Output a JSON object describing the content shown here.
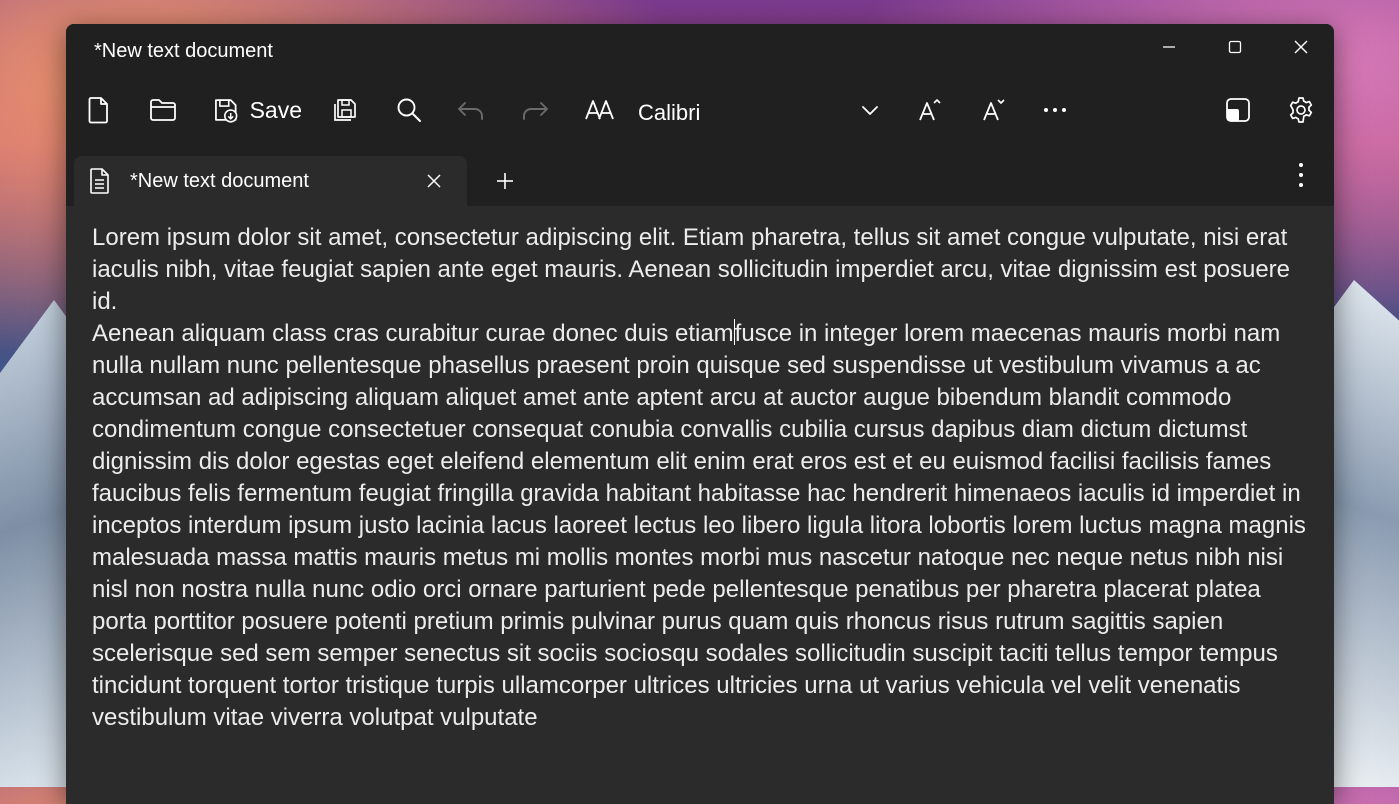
{
  "window": {
    "title": "*New text document"
  },
  "toolbar": {
    "save_label": "Save",
    "font_name": "Calibri"
  },
  "tab": {
    "label": "*New text document"
  },
  "editor": {
    "paragraph1": "Lorem ipsum dolor sit amet, consectetur adipiscing elit. Etiam pharetra, tellus sit amet congue vulputate, nisi erat iaculis nibh, vitae feugiat sapien ante eget mauris. Aenean sollicitudin imperdiet arcu, vitae dignissim est posuere id.",
    "paragraph2_before_caret": "Aenean aliquam class cras curabitur curae donec duis etiam",
    "paragraph2_after_caret": "fusce in integer lorem maecenas mauris morbi nam nulla nullam nunc pellentesque phasellus praesent proin quisque sed suspendisse ut vestibulum vivamus a ac accumsan ad adipiscing aliquam aliquet amet ante aptent arcu at auctor augue bibendum blandit commodo condimentum congue consectetuer consequat conubia convallis cubilia cursus dapibus diam dictum dictumst dignissim dis dolor egestas eget eleifend elementum elit enim erat eros est et eu euismod facilisi facilisis fames faucibus felis fermentum feugiat fringilla gravida habitant habitasse hac hendrerit himenaeos iaculis id imperdiet in inceptos interdum ipsum justo lacinia lacus laoreet lectus leo libero ligula litora lobortis lorem luctus magna magnis malesuada massa mattis mauris metus mi mollis montes morbi mus nascetur natoque nec neque netus nibh nisi nisl non nostra nulla nunc odio orci ornare parturient pede pellentesque penatibus per pharetra placerat platea porta porttitor posuere potenti pretium primis pulvinar purus quam quis rhoncus risus rutrum sagittis sapien scelerisque sed sem semper senectus sit sociis sociosqu sodales sollicitudin suscipit taciti tellus tempor tempus tincidunt torquent tortor tristique turpis ullamcorper ultrices ultricies urna ut varius vehicula vel velit venenatis vestibulum vitae viverra volutpat vulputate"
  },
  "icons": {
    "new": "new-file-icon",
    "open": "folder-icon",
    "save": "save-icon",
    "save_as": "save-as-icon",
    "find": "search-icon",
    "undo": "undo-icon",
    "redo": "redo-icon",
    "font": "font-icon",
    "increase_font": "font-increase-icon",
    "decrease_font": "font-decrease-icon",
    "more": "more-icon",
    "compact": "compact-overlay-icon",
    "settings": "gear-icon"
  },
  "colors": {
    "window_bg": "#202020",
    "editor_bg": "#2b2b2b",
    "text": "#ececec",
    "disabled": "#6b6b6b"
  }
}
